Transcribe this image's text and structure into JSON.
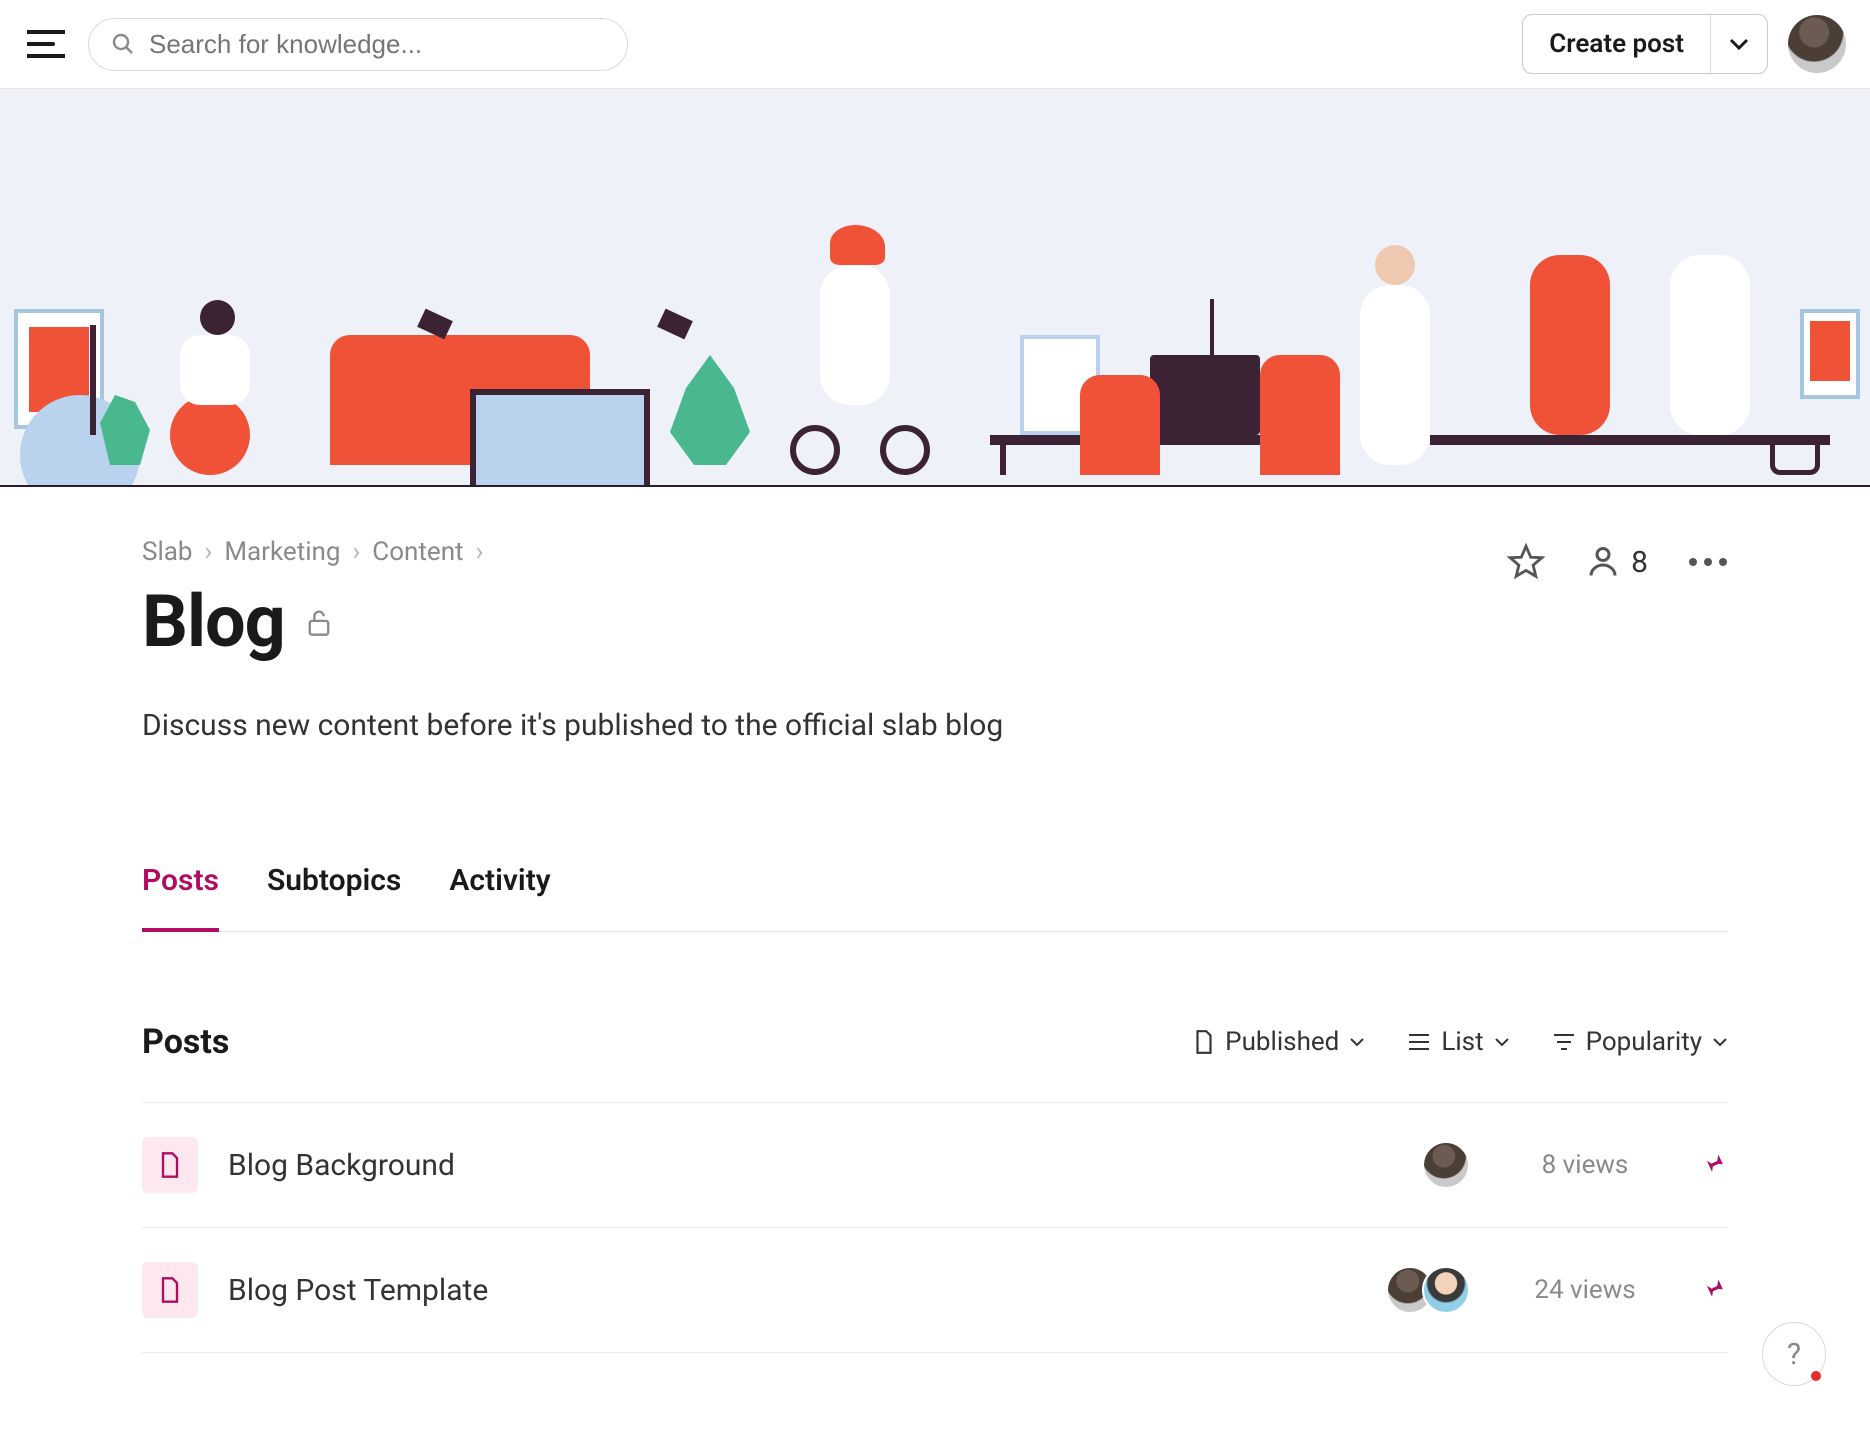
{
  "header": {
    "search_placeholder": "Search for knowledge...",
    "create_post_label": "Create post"
  },
  "breadcrumb": {
    "items": [
      "Slab",
      "Marketing",
      "Content"
    ]
  },
  "page": {
    "title": "Blog",
    "description": "Discuss new content before it's published to the official slab blog",
    "member_count": "8"
  },
  "tabs": [
    {
      "label": "Posts",
      "active": true
    },
    {
      "label": "Subtopics",
      "active": false
    },
    {
      "label": "Activity",
      "active": false
    }
  ],
  "posts_section": {
    "heading": "Posts",
    "filters": {
      "status": "Published",
      "view": "List",
      "sort": "Popularity"
    },
    "items": [
      {
        "title": "Blog Background",
        "views": "8 views",
        "authors": 1,
        "pinned": true
      },
      {
        "title": "Blog Post Template",
        "views": "24 views",
        "authors": 2,
        "pinned": true
      }
    ]
  },
  "help_label": "?"
}
